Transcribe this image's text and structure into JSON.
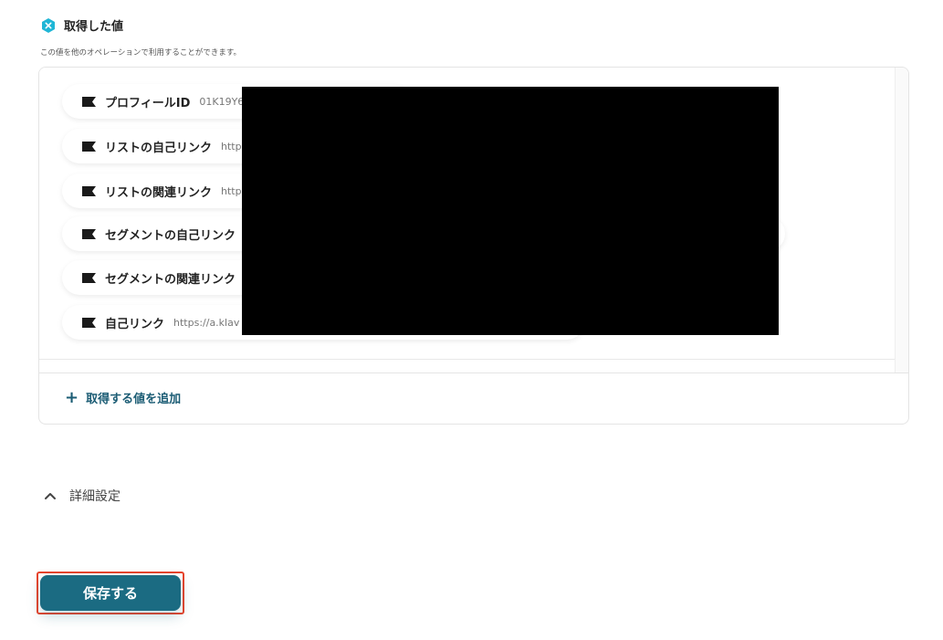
{
  "section": {
    "title": "取得した値",
    "description": "この値を他のオペレーションで利用することができます。",
    "icon": "hexagon-x-icon",
    "accent_color": "#1fb6d6"
  },
  "fields": [
    {
      "label": "プロフィールID",
      "value": "01K19Y6"
    },
    {
      "label": "リストの自己リンク",
      "value": "http"
    },
    {
      "label": "リストの関連リンク",
      "value": "http"
    },
    {
      "label": "セグメントの自己リンク",
      "value": ""
    },
    {
      "label": "セグメントの関連リンク",
      "value": ""
    },
    {
      "label": "自己リンク",
      "value": "https://a.klav"
    }
  ],
  "add_value_label": "取得する値を追加",
  "advanced_settings_label": "詳細設定",
  "save_label": "保存する",
  "colors": {
    "primary": "#1b6b82",
    "link": "#1b5c74",
    "highlight": "#e8432b"
  }
}
